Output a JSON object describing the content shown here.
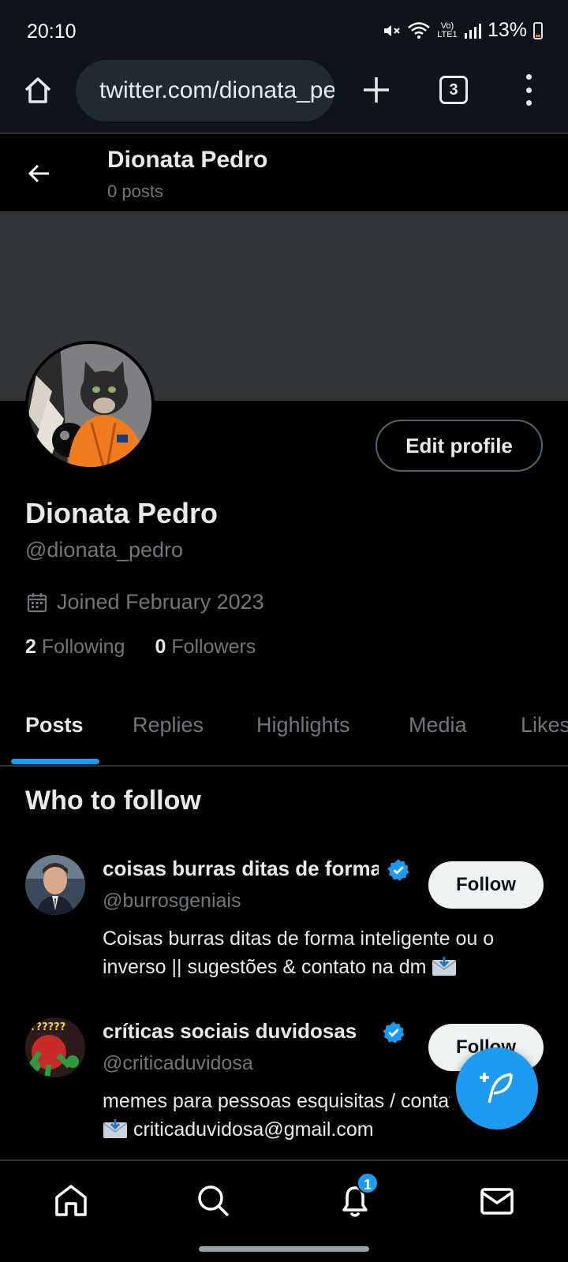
{
  "status_bar": {
    "time": "20:10",
    "battery": "13%",
    "network_label": "Vo) LTE1",
    "icons": [
      "mute-icon",
      "wifi-icon",
      "volte-icon",
      "signal-icon",
      "battery-icon"
    ]
  },
  "browser": {
    "url": "twitter.com/dionata_pedro",
    "tab_count": "3",
    "icons": [
      "home-icon",
      "site-settings-icon",
      "plus-icon",
      "tabs-icon",
      "more-vertical-icon"
    ]
  },
  "header": {
    "name": "Dionata Pedro",
    "posts": "0 posts"
  },
  "profile": {
    "name": "Dionata Pedro",
    "handle": "@dionata_pedro",
    "joined": "Joined February 2023",
    "following_count": "2",
    "following_label": "Following",
    "followers_count": "0",
    "followers_label": "Followers",
    "edit_label": "Edit profile"
  },
  "tabs": [
    "Posts",
    "Replies",
    "Highlights",
    "Media",
    "Likes"
  ],
  "who_to_follow": {
    "title": "Who to follow",
    "items": [
      {
        "name": "coisas burras ditas de forma inteligente",
        "handle": "@burrosgeniais",
        "bio": "Coisas burras ditas de forma inteligente ou o inverso || sugestões & contato na dm",
        "button": "Follow"
      },
      {
        "name": "críticas sociais duvidosas",
        "handle": "@criticaduvidosa",
        "bio_line1": "memes para pessoas esquisitas / contato",
        "bio_line2": "criticaduvidosa@gmail.com",
        "button": "Follow"
      }
    ]
  },
  "bottom_nav": {
    "items": [
      "home-icon",
      "search-icon",
      "notifications-icon",
      "messages-icon"
    ],
    "notification_count": "1"
  },
  "colors": {
    "accent": "#1d9bf0",
    "background": "#000000",
    "muted_text": "#71767b"
  }
}
